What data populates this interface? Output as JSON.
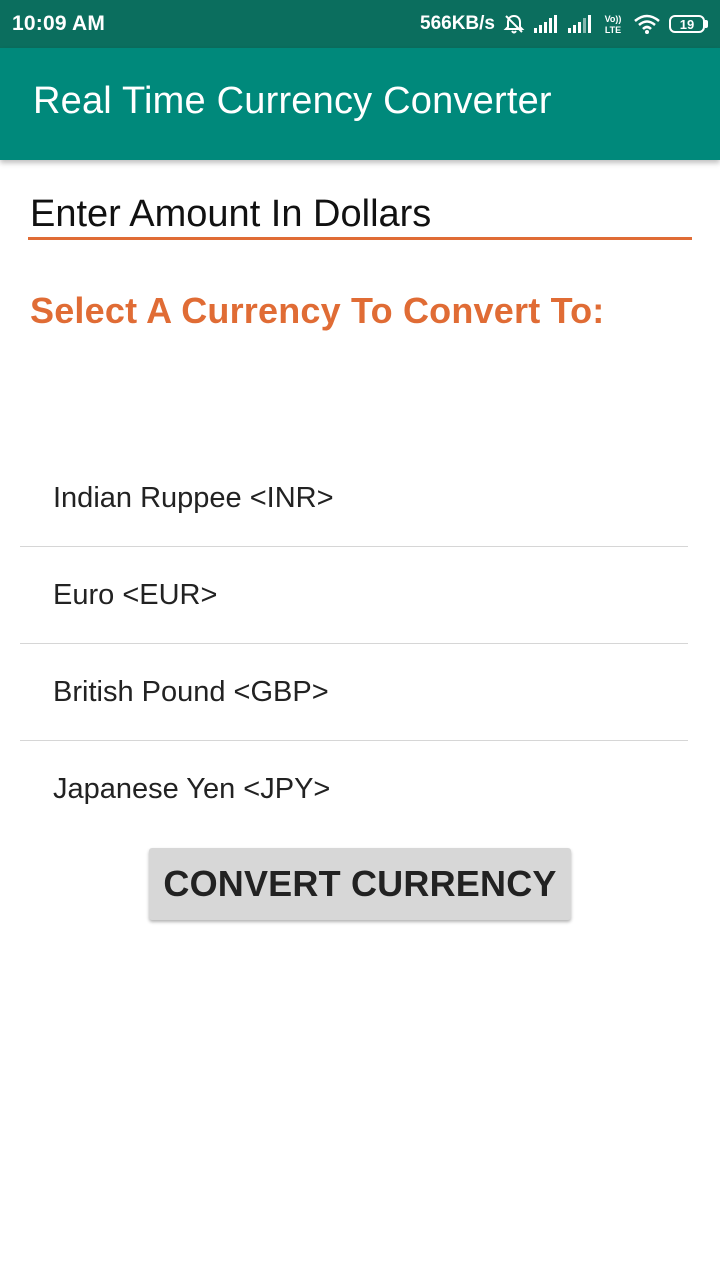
{
  "status_bar": {
    "time": "10:09 AM",
    "network_speed": "566KB/s",
    "battery_level": "19",
    "lte_label_top": "Vo))",
    "lte_label_bottom": "LTE",
    "icons": [
      "mute-icon",
      "signal-icon",
      "signal-icon",
      "volte-icon",
      "wifi-icon",
      "battery-icon"
    ]
  },
  "app_bar": {
    "title": "Real Time Currency Converter",
    "color": "#00897b"
  },
  "amount_input": {
    "placeholder": "Enter Amount In Dollars",
    "value": ""
  },
  "select_label": "Select A Currency To Convert To:",
  "currencies": [
    {
      "label": "Indian Ruppee <INR>"
    },
    {
      "label": "Euro <EUR>"
    },
    {
      "label": "British Pound <GBP>"
    },
    {
      "label": "Japanese Yen <JPY>"
    }
  ],
  "convert_button": {
    "label": "CONVERT CURRENCY"
  },
  "colors": {
    "accent": "#e06c35",
    "primary": "#00897b",
    "status_bar": "#0b6e5e"
  }
}
